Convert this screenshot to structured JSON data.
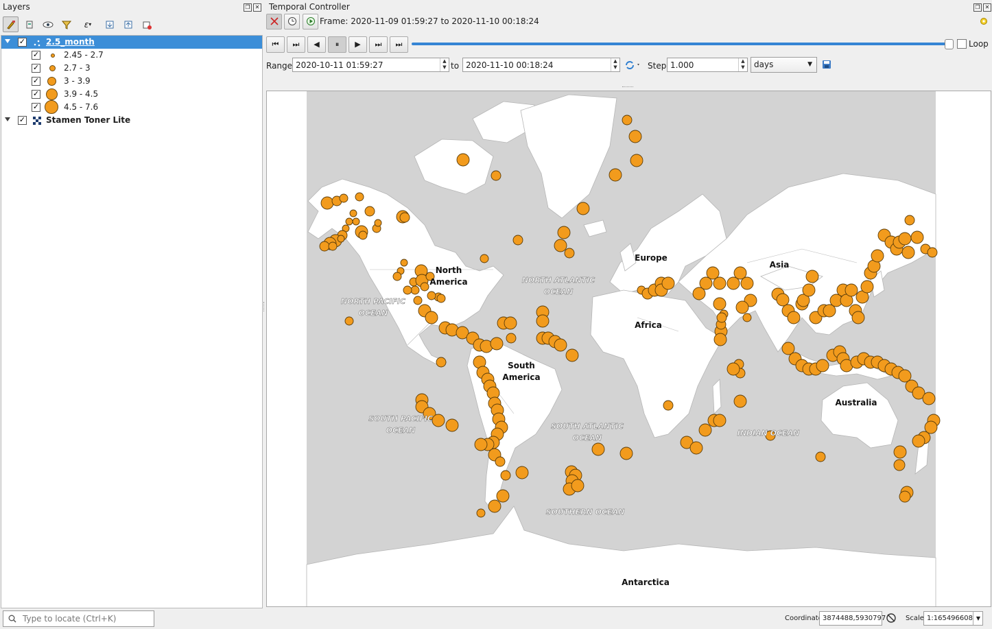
{
  "layers_panel": {
    "title": "Layers",
    "toolbar_icons": [
      "style-manager-icon",
      "add-group-icon",
      "visibility-icon",
      "filter-icon",
      "expression-filter-icon",
      "expand-all-icon",
      "collapse-all-icon",
      "remove-layer-icon"
    ],
    "tree": [
      {
        "label": "2.5_month",
        "checked": true,
        "selected": true,
        "classes": [
          {
            "label": "2.45 - 2.7"
          },
          {
            "label": "2.7 - 3"
          },
          {
            "label": "3 - 3.9"
          },
          {
            "label": "3.9 - 4.5"
          },
          {
            "label": "4.5 - 7.6"
          }
        ]
      },
      {
        "label": "Stamen Toner Lite",
        "checked": true
      }
    ]
  },
  "temporal": {
    "title": "Temporal Controller",
    "frame_text": "Frame: 2020-11-09 01:59:27 to 2020-11-10 00:18:24",
    "range_label": "Range",
    "range_start": "2020-10-11 01:59:27",
    "to_label": "to",
    "range_end": "2020-11-10 00:18:24",
    "step_label": "Step",
    "step_value": "1.000",
    "step_unit": "days",
    "loop_label": "Loop",
    "loop_checked": false,
    "slider_position": 0.995
  },
  "map": {
    "labels": {
      "north_america": "North\nAmerica",
      "south_america": "South\nAmerica",
      "europe": "Europe",
      "africa": "Africa",
      "asia": "Asia",
      "australia": "Australia",
      "antarctica": "Antarctica",
      "north_pacific": "NORTH PACIFIC\nOCEAN",
      "north_atlantic": "NORTH ATLANTIC\nOCEAN",
      "south_pacific": "SOUTH PACIFIC\nOCEAN",
      "south_atlantic": "SOUTH ATLANTIC\nOCEAN",
      "indian_ocean": "INDIAN OCEAN",
      "southern_ocean": "SOUTHERN OCEAN"
    },
    "colors": {
      "ocean": "#d3d3d3",
      "land": "#ffffff",
      "marker": "#f29b1d",
      "marker_stroke": "#5a3c0a"
    }
  },
  "statusbar": {
    "search_placeholder": "Type to locate (Ctrl+K)",
    "coordinate_label": "Coordinate",
    "coordinate_value": "3874488,5930797",
    "scale_label": "Scale",
    "scale_value": "1:165496608"
  }
}
